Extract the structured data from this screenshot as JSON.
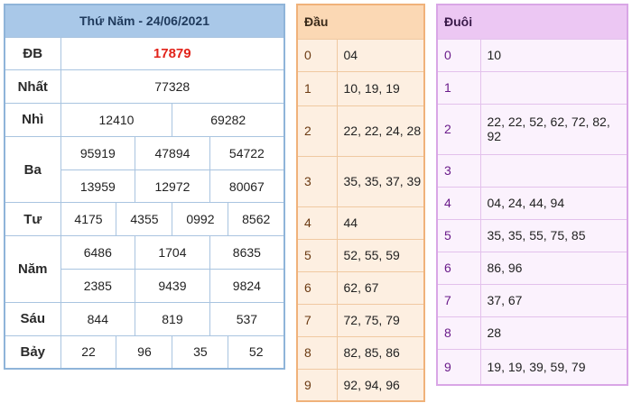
{
  "results": {
    "title": "Thứ Năm - 24/06/2021",
    "rows": {
      "db": {
        "label": "ĐB",
        "values": [
          "17879"
        ]
      },
      "nhat": {
        "label": "Nhất",
        "values": [
          "77328"
        ]
      },
      "nhi": {
        "label": "Nhì",
        "values": [
          "12410",
          "69282"
        ]
      },
      "ba": {
        "label": "Ba",
        "values": [
          "95919",
          "47894",
          "54722",
          "13959",
          "12972",
          "80067"
        ]
      },
      "tu": {
        "label": "Tư",
        "values": [
          "4175",
          "4355",
          "0992",
          "8562"
        ]
      },
      "nam": {
        "label": "Năm",
        "values": [
          "6486",
          "1704",
          "8635",
          "2385",
          "9439",
          "9824"
        ]
      },
      "sau": {
        "label": "Sáu",
        "values": [
          "844",
          "819",
          "537"
        ]
      },
      "bay": {
        "label": "Bảy",
        "values": [
          "22",
          "96",
          "35",
          "52"
        ]
      }
    },
    "highlight_color": "#e2231a"
  },
  "dau": {
    "header": "Đầu",
    "rows": [
      {
        "digit": "0",
        "values": "04"
      },
      {
        "digit": "1",
        "values": "10, 19, 19"
      },
      {
        "digit": "2",
        "values": "22, 22, 24, 28"
      },
      {
        "digit": "3",
        "values": "35, 35, 37, 39"
      },
      {
        "digit": "4",
        "values": "44"
      },
      {
        "digit": "5",
        "values": "52, 55, 59"
      },
      {
        "digit": "6",
        "values": "62, 67"
      },
      {
        "digit": "7",
        "values": "72, 75, 79"
      },
      {
        "digit": "8",
        "values": "82, 85, 86"
      },
      {
        "digit": "9",
        "values": "92, 94, 96"
      }
    ]
  },
  "duoi": {
    "header": "Đuôi",
    "rows": [
      {
        "digit": "0",
        "values": "10"
      },
      {
        "digit": "1",
        "values": ""
      },
      {
        "digit": "2",
        "values": "22, 22, 52, 62, 72, 82, 92"
      },
      {
        "digit": "3",
        "values": ""
      },
      {
        "digit": "4",
        "values": "04, 24, 44, 94"
      },
      {
        "digit": "5",
        "values": "35, 35, 55, 75, 85"
      },
      {
        "digit": "6",
        "values": "86, 96"
      },
      {
        "digit": "7",
        "values": "37, 67"
      },
      {
        "digit": "8",
        "values": "28"
      },
      {
        "digit": "9",
        "values": "19, 19, 39, 59, 79"
      }
    ]
  }
}
